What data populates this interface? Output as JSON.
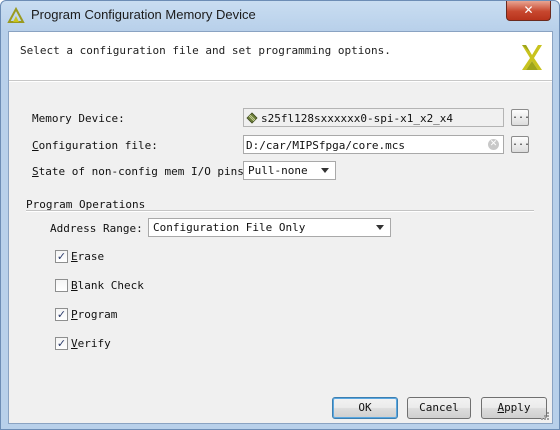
{
  "window": {
    "title": "Program Configuration Memory Device",
    "close_glyph": "✕"
  },
  "header": {
    "instruction": "Select a configuration file and set programming options."
  },
  "memory_device": {
    "label": "Memory Device:",
    "value": "s25fl128sxxxxxx0-spi-x1_x2_x4",
    "icon": "chip-icon",
    "browse_label": "..."
  },
  "config_file": {
    "label_prefix": "C",
    "label_rest": "onfiguration file:",
    "value": "D:/car/MIPSfpga/core.mcs",
    "browse_label": "..."
  },
  "pins": {
    "label_prefix": "S",
    "label_rest": "tate of non-config mem I/O pins:",
    "selected": "Pull-none"
  },
  "program_operations": {
    "group_label": "Program Operations",
    "address_range_label": "Address Range:",
    "address_range_selected": "Configuration File Only",
    "options": [
      {
        "prefix": "E",
        "rest": "rase",
        "checked": true
      },
      {
        "prefix": "B",
        "rest": "lank Check",
        "checked": false
      },
      {
        "prefix": "P",
        "rest": "rogram",
        "checked": true
      },
      {
        "prefix": "V",
        "rest": "erify",
        "checked": true
      }
    ],
    "check_glyph": "✓"
  },
  "buttons": {
    "ok": "OK",
    "cancel": "Cancel",
    "apply_prefix": "A",
    "apply_rest": "pply"
  },
  "colors": {
    "title_bar": "#c9ddf1",
    "close_red": "#c7472e",
    "logo_yellow": "#c8c31e",
    "default_button_border": "#3c7fb1"
  }
}
